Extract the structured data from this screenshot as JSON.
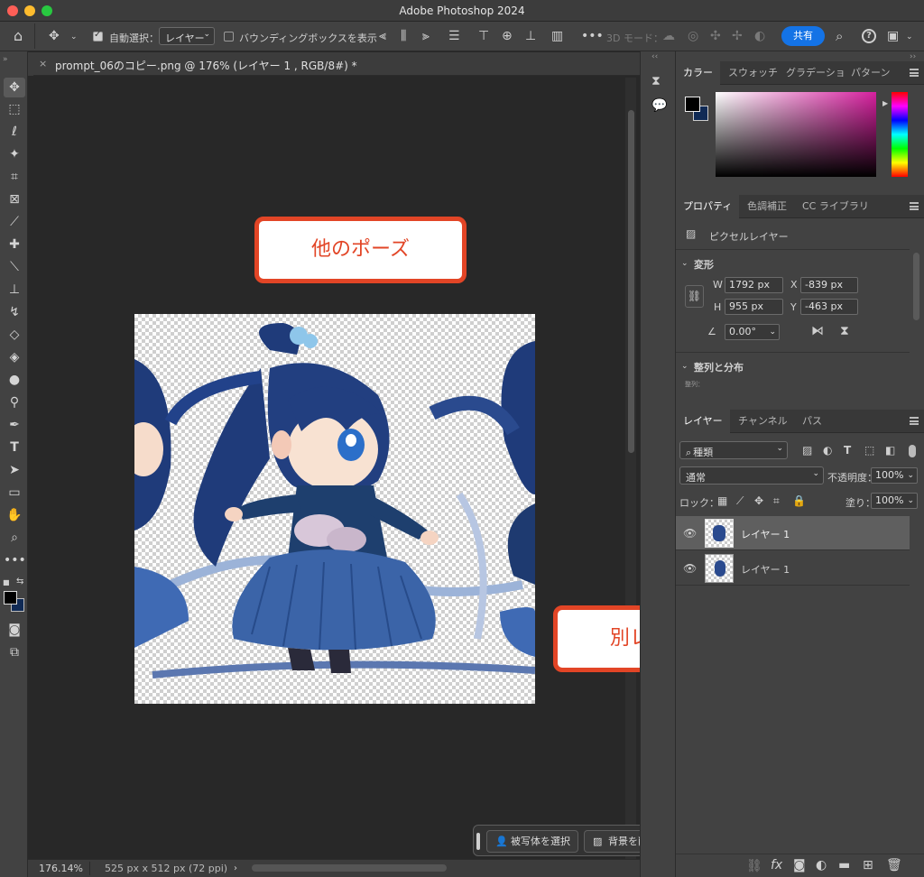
{
  "window": {
    "title": "Adobe Photoshop 2024"
  },
  "options_bar": {
    "auto_select_label": "自動選択：",
    "auto_select_value": "レイヤー",
    "bounding_box_label": "バウンディングボックスを表示",
    "mode_3d_label": "3D モード：",
    "share_label": "共有"
  },
  "document": {
    "tab_title": "prompt_06のコピー.png @ 176% (レイヤー 1 , RGB/8#) *",
    "zoom": "176.14%",
    "doc_info": "525 px x 512 px (72 ppi)"
  },
  "callouts": {
    "other_pose": "他のポーズ",
    "separate_layer": "別レイヤー"
  },
  "context_bar": {
    "select_subject": "被写体を選択",
    "remove_background": "背景を削除"
  },
  "color_panel": {
    "tabs": [
      "カラー",
      "スウォッチ",
      "グラデーショ",
      "パターン"
    ],
    "foreground": "#000000",
    "background": "#102a55"
  },
  "properties_panel": {
    "tabs": [
      "プロパティ",
      "色調補正",
      "CC ライブラリ"
    ],
    "layer_type": "ピクセルレイヤー",
    "transform_title": "変形",
    "w_label": "W",
    "w_value": "1792 px",
    "h_label": "H",
    "h_value": "955 px",
    "x_label": "X",
    "x_value": "-839 px",
    "y_label": "Y",
    "y_value": "-463 px",
    "angle_value": "0.00°",
    "align_title": "整列と分布",
    "align_sub": "整列："
  },
  "layers_panel": {
    "tabs": [
      "レイヤー",
      "チャンネル",
      "パス"
    ],
    "filter_kind": "種類",
    "blend_mode": "通常",
    "opacity_label": "不透明度：",
    "opacity_value": "100%",
    "lock_label": "ロック：",
    "fill_label": "塗り：",
    "fill_value": "100%",
    "layers": [
      {
        "name": "レイヤー 1",
        "selected": true
      },
      {
        "name": "レイヤー 1",
        "selected": false
      }
    ]
  },
  "colors": {
    "accent": "#1473e6",
    "callout": "#e24526"
  }
}
